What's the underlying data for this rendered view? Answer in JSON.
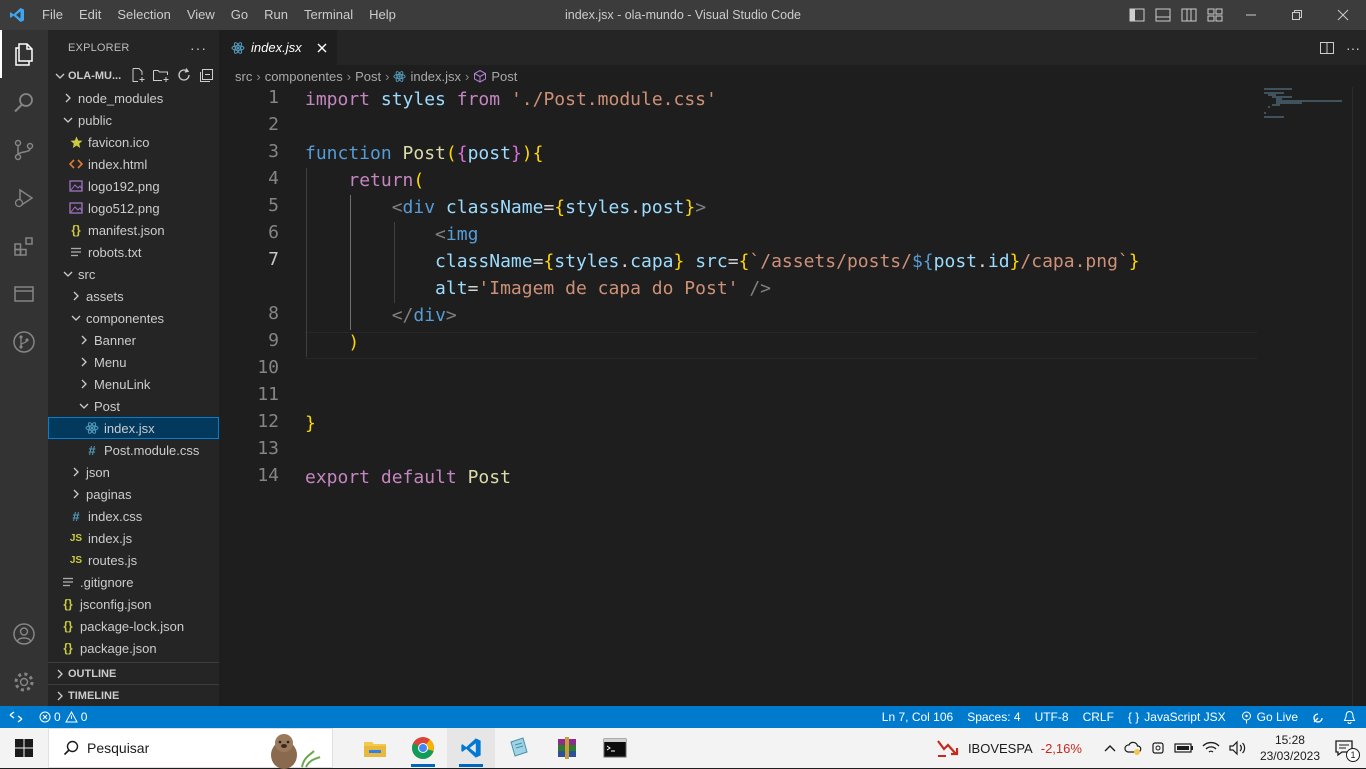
{
  "window": {
    "title": "index.jsx - ola-mundo - Visual Studio Code"
  },
  "menu": [
    "File",
    "Edit",
    "Selection",
    "View",
    "Go",
    "Run",
    "Terminal",
    "Help"
  ],
  "sidebar": {
    "header": "EXPLORER",
    "folder": "OLA-MU...",
    "tree": [
      {
        "label": "node_modules",
        "kind": "folder",
        "open": false
      },
      {
        "label": "public",
        "kind": "folder",
        "open": true
      },
      {
        "label": "favicon.ico",
        "kind": "star"
      },
      {
        "label": "index.html",
        "kind": "html"
      },
      {
        "label": "logo192.png",
        "kind": "image"
      },
      {
        "label": "logo512.png",
        "kind": "image"
      },
      {
        "label": "manifest.json",
        "kind": "json"
      },
      {
        "label": "robots.txt",
        "kind": "text"
      },
      {
        "label": "src",
        "kind": "folder",
        "open": true
      },
      {
        "label": "assets",
        "kind": "folder",
        "open": false
      },
      {
        "label": "componentes",
        "kind": "folder",
        "open": true
      },
      {
        "label": "Banner",
        "kind": "folder",
        "open": false
      },
      {
        "label": "Menu",
        "kind": "folder",
        "open": false
      },
      {
        "label": "MenuLink",
        "kind": "folder",
        "open": false
      },
      {
        "label": "Post",
        "kind": "folder",
        "open": true
      },
      {
        "label": "index.jsx",
        "kind": "react",
        "selected": true
      },
      {
        "label": "Post.module.css",
        "kind": "css"
      },
      {
        "label": "json",
        "kind": "folder",
        "open": false
      },
      {
        "label": "paginas",
        "kind": "folder",
        "open": false
      },
      {
        "label": "index.css",
        "kind": "css"
      },
      {
        "label": "index.js",
        "kind": "js"
      },
      {
        "label": "routes.js",
        "kind": "js"
      },
      {
        "label": ".gitignore",
        "kind": "text"
      },
      {
        "label": "jsconfig.json",
        "kind": "json"
      },
      {
        "label": "package-lock.json",
        "kind": "json"
      },
      {
        "label": "package.json",
        "kind": "json"
      }
    ],
    "sections": [
      "OUTLINE",
      "TIMELINE"
    ]
  },
  "editor": {
    "tab": "index.jsx",
    "breadcrumb": [
      "src",
      "componentes",
      "Post",
      "index.jsx",
      "Post"
    ],
    "line_numbers": [
      "1",
      "2",
      "3",
      "4",
      "5",
      "6",
      "7",
      "",
      "8",
      "9",
      "10",
      "11",
      "12",
      "13",
      "14"
    ],
    "code_lines": [
      "import styles from './Post.module.css'",
      "",
      "function Post({post}){",
      "    return(",
      "        <div className={styles.post}>",
      "            <img",
      "            className={styles.capa} src={`/assets/posts/${post.id}/capa.png`}",
      "            alt='Imagem de capa do Post' />",
      "        </div>",
      "    )",
      "",
      "",
      "}",
      "",
      "export default Post"
    ]
  },
  "status": {
    "errors": "0",
    "warnings": "0",
    "position": "Ln 7, Col 106",
    "spaces": "Spaces: 4",
    "encoding": "UTF-8",
    "eol": "CRLF",
    "language": "JavaScript JSX",
    "golive": "Go Live"
  },
  "taskbar": {
    "search_placeholder": "Pesquisar",
    "stock_name": "IBOVESPA",
    "stock_change": "-2,16%",
    "time": "15:28",
    "date": "23/03/2023",
    "notifications": "1"
  },
  "colors": {
    "accent": "#007acc",
    "stock_negative": "#c42b1c"
  }
}
